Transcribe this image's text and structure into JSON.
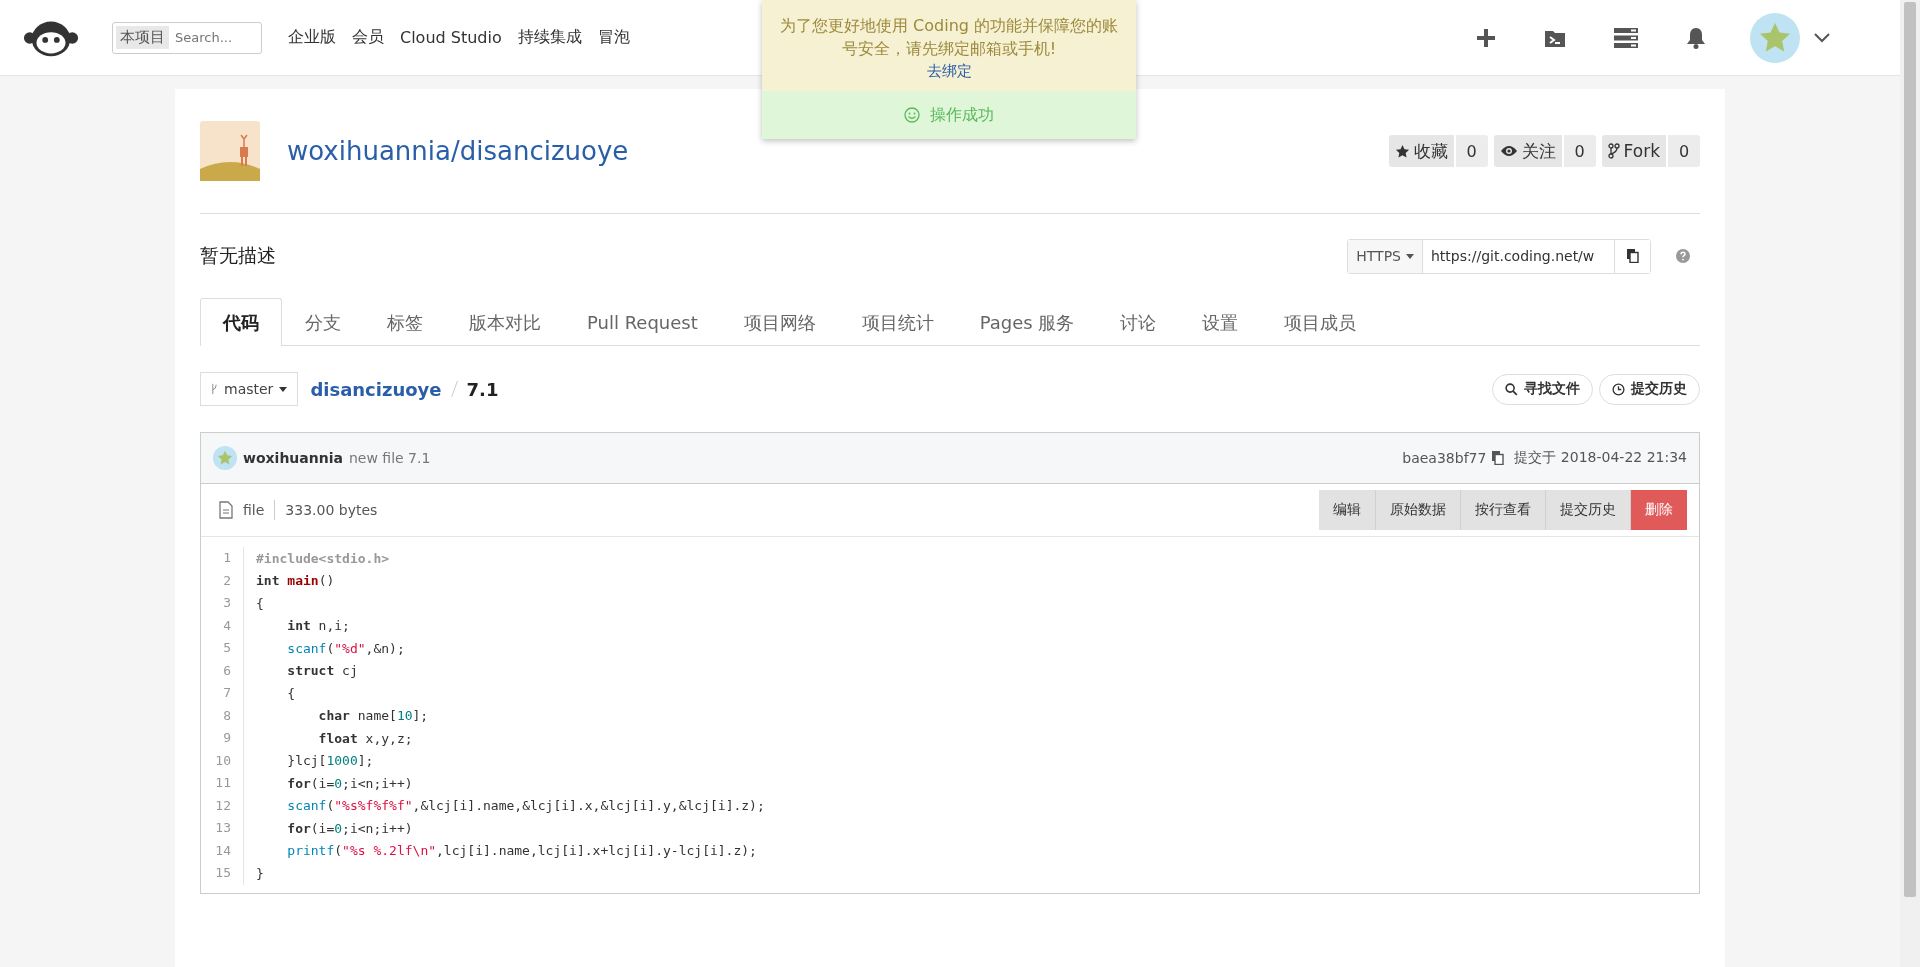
{
  "topbar": {
    "search": {
      "scope": "本项目",
      "placeholder": "Search..."
    },
    "nav": [
      "企业版",
      "会员",
      "Cloud Studio",
      "持续集成",
      "冒泡"
    ],
    "actions": [
      {
        "kind": "plus"
      },
      {
        "kind": "terminal"
      },
      {
        "kind": "server"
      },
      {
        "kind": "bell"
      }
    ]
  },
  "notice": {
    "message": "为了您更好地使用 Coding 的功能并保障您的账号安全，请先绑定邮箱或手机!",
    "link": "去绑定",
    "success": "操作成功"
  },
  "repo": {
    "title": "woxihuannia/disancizuoye",
    "description": "暂无描述",
    "stats": [
      {
        "kind": "star",
        "label": "收藏",
        "count": "0"
      },
      {
        "kind": "eye",
        "label": "关注",
        "count": "0"
      },
      {
        "kind": "fork",
        "label": "Fork",
        "count": "0"
      }
    ],
    "clone": {
      "protocol": "HTTPS",
      "url": "https://git.coding.net/w"
    }
  },
  "tabs": [
    {
      "label": "代码",
      "selected": true
    },
    {
      "label": "分支",
      "selected": false
    },
    {
      "label": "标签",
      "selected": false
    },
    {
      "label": "版本对比",
      "selected": false
    },
    {
      "label": "Pull Request",
      "selected": false
    },
    {
      "label": "项目网络",
      "selected": false
    },
    {
      "label": "项目统计",
      "selected": false
    },
    {
      "label": "Pages 服务",
      "selected": false
    },
    {
      "label": "讨论",
      "selected": false
    },
    {
      "label": "设置",
      "selected": false
    },
    {
      "label": "项目成员",
      "selected": false
    }
  ],
  "branch": "master",
  "breadcrumb": {
    "repo": "disancizuoye",
    "file": "7.1"
  },
  "tools": [
    {
      "kind": "search",
      "label": "寻找文件"
    },
    {
      "kind": "clock",
      "label": "提交历史"
    }
  ],
  "commit": {
    "author": "woxihuannia",
    "message": "new file 7.1",
    "hash": "baea38bf77",
    "time": "提交于 2018-04-22 21:34"
  },
  "file": {
    "type": "file",
    "size": "333.00 bytes",
    "actions": [
      {
        "label": "编辑",
        "kind": "normal"
      },
      {
        "label": "原始数据",
        "kind": "normal"
      },
      {
        "label": "按行查看",
        "kind": "normal"
      },
      {
        "label": "提交历史",
        "kind": "normal"
      },
      {
        "label": "删除",
        "kind": "danger"
      }
    ]
  },
  "code": [
    {
      "number": "1",
      "tokens": [
        {
          "text": "#include<stdio.h>",
          "kind": "meta"
        }
      ]
    },
    {
      "number": "2",
      "tokens": [
        {
          "text": "int",
          "kind": "keyword"
        },
        {
          "text": " main",
          "kind": "title"
        },
        {
          "text": "()",
          "kind": "plain"
        }
      ]
    },
    {
      "number": "3",
      "tokens": [
        {
          "text": "{",
          "kind": "plain"
        }
      ]
    },
    {
      "number": "4",
      "tokens": [
        {
          "text": "    int",
          "kind": "keyword"
        },
        {
          "text": " n,i;",
          "kind": "plain"
        }
      ]
    },
    {
      "number": "5",
      "tokens": [
        {
          "text": "    scanf",
          "kind": "builtin"
        },
        {
          "text": "(",
          "kind": "plain"
        },
        {
          "text": "\"%d\"",
          "kind": "string"
        },
        {
          "text": ",&n);",
          "kind": "plain"
        }
      ]
    },
    {
      "number": "6",
      "tokens": [
        {
          "text": "    struct",
          "kind": "keyword"
        },
        {
          "text": " cj",
          "kind": "plain"
        }
      ]
    },
    {
      "number": "7",
      "tokens": [
        {
          "text": "    {",
          "kind": "plain"
        }
      ]
    },
    {
      "number": "8",
      "tokens": [
        {
          "text": "        char",
          "kind": "keyword"
        },
        {
          "text": " name[",
          "kind": "plain"
        },
        {
          "text": "10",
          "kind": "number"
        },
        {
          "text": "];",
          "kind": "plain"
        }
      ]
    },
    {
      "number": "9",
      "tokens": [
        {
          "text": "        float",
          "kind": "keyword"
        },
        {
          "text": " x,y,z;",
          "kind": "plain"
        }
      ]
    },
    {
      "number": "10",
      "tokens": [
        {
          "text": "    }lcj[",
          "kind": "plain"
        },
        {
          "text": "1000",
          "kind": "number"
        },
        {
          "text": "];",
          "kind": "plain"
        }
      ]
    },
    {
      "number": "11",
      "tokens": [
        {
          "text": "    for",
          "kind": "keyword"
        },
        {
          "text": "(i=",
          "kind": "plain"
        },
        {
          "text": "0",
          "kind": "number"
        },
        {
          "text": ";i<n;i++)",
          "kind": "plain"
        }
      ]
    },
    {
      "number": "12",
      "tokens": [
        {
          "text": "    scanf",
          "kind": "builtin"
        },
        {
          "text": "(",
          "kind": "plain"
        },
        {
          "text": "\"%s%f%f%f\"",
          "kind": "string"
        },
        {
          "text": ",&lcj[i].name,&lcj[i].x,&lcj[i].y,&lcj[i].z);",
          "kind": "plain"
        }
      ]
    },
    {
      "number": "13",
      "tokens": [
        {
          "text": "    for",
          "kind": "keyword"
        },
        {
          "text": "(i=",
          "kind": "plain"
        },
        {
          "text": "0",
          "kind": "number"
        },
        {
          "text": ";i<n;i++)",
          "kind": "plain"
        }
      ]
    },
    {
      "number": "14",
      "tokens": [
        {
          "text": "    printf",
          "kind": "builtin"
        },
        {
          "text": "(",
          "kind": "plain"
        },
        {
          "text": "\"%s %.2lf\\n\"",
          "kind": "string"
        },
        {
          "text": ",lcj[i].name,lcj[i].x+lcj[i].y-lcj[i].z);",
          "kind": "plain"
        }
      ]
    },
    {
      "number": "15",
      "tokens": [
        {
          "text": "}",
          "kind": "plain"
        }
      ]
    }
  ]
}
